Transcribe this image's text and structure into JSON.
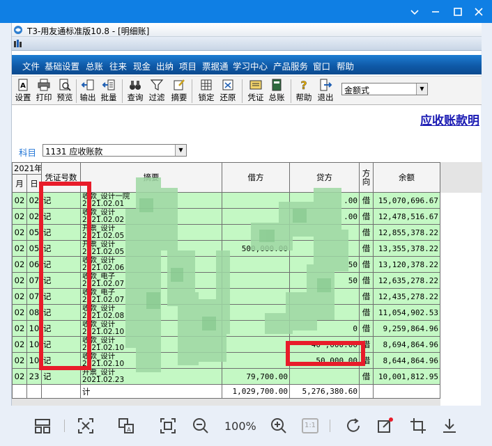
{
  "app": {
    "title": "T3-用友通标准版10.8 - [明细账]"
  },
  "menu": [
    "文件",
    "基础设置",
    "总账",
    "往来",
    "现金",
    "出纳",
    "项目",
    "票据通",
    "学习中心",
    "产品服务",
    "窗口",
    "帮助"
  ],
  "toolbar": {
    "buttons": [
      "设置",
      "打印",
      "预览",
      "输出",
      "批量",
      "查询",
      "过滤",
      "摘要",
      "锁定",
      "还原",
      "凭证",
      "总账",
      "帮助",
      "退出"
    ],
    "format_combo": "金额式"
  },
  "report": {
    "title": "应收账款明",
    "subject_label": "科目",
    "subject_value": "1131 应收账款"
  },
  "table": {
    "year_header": "2021年",
    "month_header": "月",
    "day_header": "日",
    "voucher_header": "凭证号数",
    "summary_header": "摘要",
    "debit_header": "借方",
    "credit_header": "贷方",
    "direction_header": "方向",
    "balance_header": "余额",
    "rows": [
      {
        "m": "02",
        "d": "02",
        "v": "记",
        "s1": "收款_设计一院",
        "s2": "2021.02.01",
        "debit": "",
        "credit": ".00",
        "dir": "借",
        "bal": "15,070,696.67"
      },
      {
        "m": "02",
        "d": "02",
        "v": "记",
        "s1": "收款_设计",
        "s2": "2021.02.02",
        "debit": "",
        "credit": ".00",
        "dir": "借",
        "bal": "12,478,516.67"
      },
      {
        "m": "02",
        "d": "05",
        "v": "记",
        "s1": "开票_设计",
        "s2": "2021.02.05",
        "debit": "",
        "credit": "",
        "dir": "借",
        "bal": "12,855,378.22"
      },
      {
        "m": "02",
        "d": "05",
        "v": "记",
        "s1": "开票_设计",
        "s2": "2021.02.05",
        "debit": "500,000.00",
        "credit": "",
        "dir": "借",
        "bal": "13,355,378.22"
      },
      {
        "m": "02",
        "d": "06",
        "v": "记",
        "s1": "收款_设计",
        "s2": "2021.02.06",
        "debit": "",
        "credit": "50",
        "dir": "借",
        "bal": "13,120,378.22"
      },
      {
        "m": "02",
        "d": "07",
        "v": "记",
        "s1": "收款_电子",
        "s2": "2021.02.07",
        "debit": "",
        "credit": "50",
        "dir": "借",
        "bal": "12,635,278.22"
      },
      {
        "m": "02",
        "d": "07",
        "v": "记",
        "s1": "收款_电子",
        "s2": "2021.02.07",
        "debit": "",
        "credit": "",
        "dir": "借",
        "bal": "12,435,278.22"
      },
      {
        "m": "02",
        "d": "08",
        "v": "记",
        "s1": "收款_设计",
        "s2": "2021.02.08",
        "debit": "",
        "credit": "",
        "dir": "借",
        "bal": "11,054,902.53"
      },
      {
        "m": "02",
        "d": "10",
        "v": "记",
        "s1": "收款_设计",
        "s2": "2021.02.10",
        "debit": "",
        "credit": "0",
        "dir": "借",
        "bal": "9,259,864.96"
      },
      {
        "m": "02",
        "d": "10",
        "v": "记",
        "s1": "收款_设计",
        "s2": "2021.02.10",
        "debit": "",
        "credit": "40 ,000.00",
        "dir": "借",
        "bal": "8,694,864.96"
      },
      {
        "m": "02",
        "d": "10",
        "v": "记",
        "s1": "收款_设计",
        "s2": "2021.02.10",
        "debit": "",
        "credit": "50,000.00",
        "dir": "借",
        "bal": "8,644,864.96"
      },
      {
        "m": "02",
        "d": "23",
        "v": "记",
        "s1": "开票_设计",
        "s2": "2021.02.23",
        "debit": "79,700.00",
        "credit": "",
        "dir": "借",
        "bal": "10,001,812.95"
      }
    ],
    "total": {
      "label": "计",
      "debit": "1,029,700.00",
      "credit": "5,276,380.60"
    }
  },
  "viewer": {
    "zoom": "100%",
    "ratio_label": "1:1"
  }
}
